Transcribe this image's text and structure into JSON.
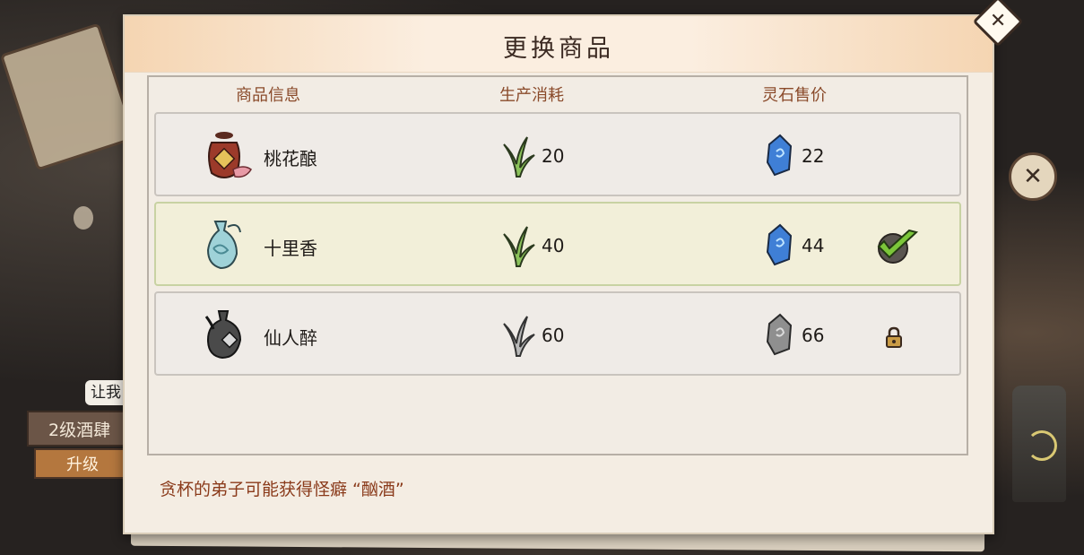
{
  "dialog": {
    "title": "更换商品"
  },
  "columns": {
    "info": "商品信息",
    "cost": "生产消耗",
    "price": "灵石售价"
  },
  "items": [
    {
      "name": "桃花酿",
      "cost": "20",
      "price": "22",
      "status": "available",
      "icon": "wine-jar-icon"
    },
    {
      "name": "十里香",
      "cost": "40",
      "price": "44",
      "status": "selected",
      "icon": "porcelain-vase-icon"
    },
    {
      "name": "仙人醉",
      "cost": "60",
      "price": "66",
      "status": "locked",
      "icon": "gourd-flask-icon"
    }
  ],
  "footer": {
    "hint": "贪杯的弟子可能获得怪癖 “酗酒”"
  },
  "background": {
    "chat_fragment": "让我",
    "sign_fragment": "2级酒肆",
    "upgrade_label": "升级"
  },
  "colors": {
    "accent_brown": "#8a4a2a",
    "selected_row": "#f2efd9",
    "stone_blue": "#3f7fd6",
    "check_green": "#7cc63a"
  }
}
